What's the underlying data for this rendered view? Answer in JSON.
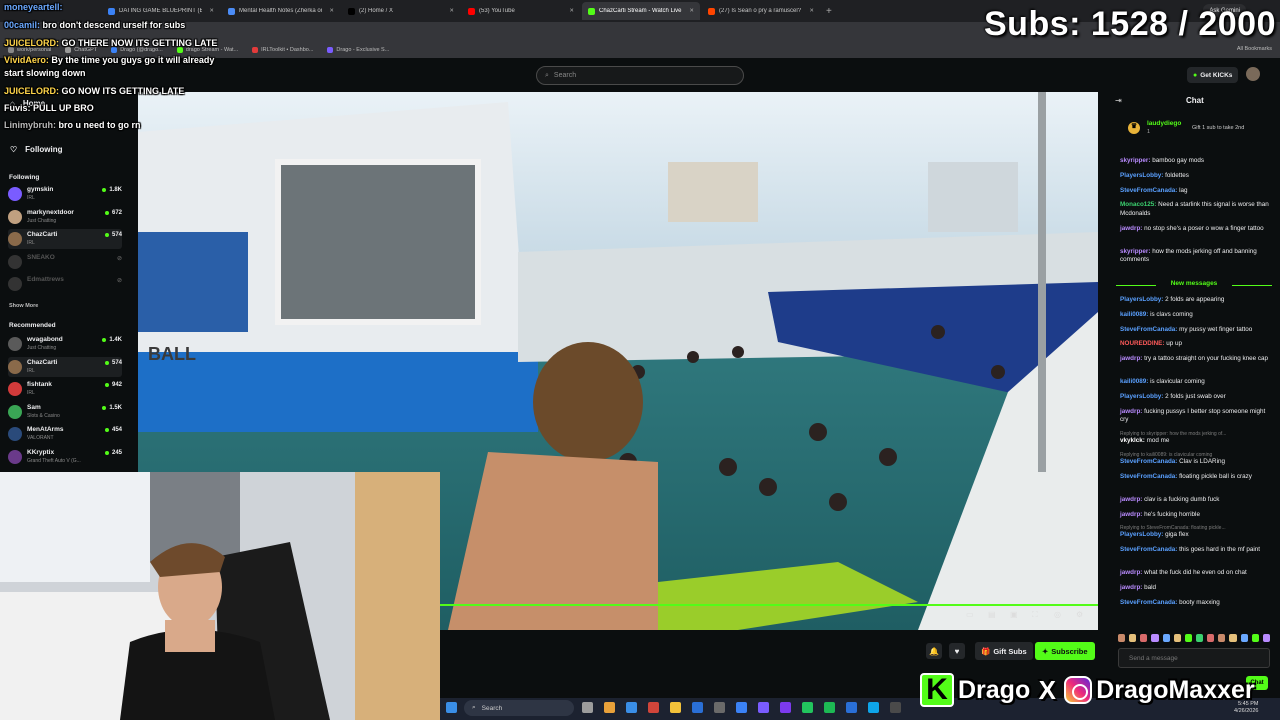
{
  "browser": {
    "tabs": [
      {
        "label": "DATING GAME BLUEPRINT (Be",
        "color": "#3b82f6",
        "active": false
      },
      {
        "label": "Mental Health Notes (Zherka or",
        "color": "#4b8cf6",
        "active": false
      },
      {
        "label": "(2) Home / X",
        "color": "#000000",
        "active": false
      },
      {
        "label": "(53) YouTube",
        "color": "#ff0000",
        "active": false
      },
      {
        "label": "ChazCarti Stream - Watch Live",
        "color": "#53fc18",
        "active": true
      },
      {
        "label": "(27) Is Sean o pry a ramuscel? |",
        "color": "#ff4500",
        "active": false
      }
    ],
    "ask_gemini": "Ask Gemini",
    "bookmarks": [
      "work/personal",
      "ChatGPT",
      "Drago (@drago...",
      "drago Stream - Wat...",
      "IRLToolkit • Dashbo...",
      "Drago - Exclusive S..."
    ],
    "all_bookmarks": "All Bookmarks"
  },
  "header": {
    "search_placeholder": "Search",
    "get_kicks": "Get KICKs"
  },
  "sidebar": {
    "nav_home": "Home",
    "nav_following": "Following",
    "following_title": "Following",
    "following": [
      {
        "name": "gymskin",
        "sub": "IRL",
        "viewers": "1.8K",
        "color": "#7a5cff",
        "off": false
      },
      {
        "name": "markynextdoor",
        "sub": "Just Chatting",
        "viewers": "672",
        "color": "#c0a080",
        "off": false
      },
      {
        "name": "ChazCarti",
        "sub": "IRL",
        "viewers": "574",
        "color": "#8a6a4a",
        "off": false
      },
      {
        "name": "SNEAKO",
        "sub": "",
        "viewers": "",
        "color": "#333333",
        "off": true
      },
      {
        "name": "Edmattrews",
        "sub": "",
        "viewers": "",
        "color": "#333333",
        "off": true
      }
    ],
    "show_more": "Show More",
    "recommended_title": "Recommended",
    "recommended": [
      {
        "name": "wvagabond",
        "sub": "Just Chatting",
        "viewers": "1.4K",
        "color": "#5a5a5a"
      },
      {
        "name": "ChazCarti",
        "sub": "IRL",
        "viewers": "574",
        "color": "#8a6a4a"
      },
      {
        "name": "fishtank",
        "sub": "IRL",
        "viewers": "942",
        "color": "#d23b3b"
      },
      {
        "name": "Sam",
        "sub": "Slots & Casino",
        "viewers": "1.5K",
        "color": "#3aa655"
      },
      {
        "name": "MenAtArms",
        "sub": "VALORANT",
        "viewers": "454",
        "color": "#2a4a7a"
      },
      {
        "name": "KKryptix",
        "sub": "Grand Theft Auto V (G...",
        "viewers": "245",
        "color": "#6a3a8a"
      }
    ]
  },
  "overlay_chat": [
    {
      "user": "moneyeartell:",
      "text": "",
      "color": "#6aa8ff"
    },
    {
      "user": "00camil:",
      "text": "bro don't descend urself for subs",
      "color": "#6aa8ff"
    },
    {
      "user": "JUICELORD:",
      "text": "GO THERE NOW ITS GETTING LATE",
      "color": "#ffd54a"
    },
    {
      "user": "VividAero:",
      "text": "By the time you guys go it will already",
      "color": "#ffd54a"
    },
    {
      "user": "",
      "text": "start slowing down",
      "color": "#ffffff"
    },
    {
      "user": "JUICELORD:",
      "text": "GO NOW ITS GETTING LATE",
      "color": "#ffd54a"
    },
    {
      "user": "Fuvis:",
      "text": "PULL UP BRO",
      "color": "#ffffff"
    },
    {
      "user": "Linimybruh:",
      "text": "bro u need to go rn",
      "color": "#b8b8b8"
    }
  ],
  "subs_counter": "Subs: 1528 / 2000",
  "stream": {
    "gift_subs": "Gift Subs",
    "subscribe": "Subscribe"
  },
  "chat": {
    "title": "Chat",
    "pinned_user": "laudydiego",
    "pinned_count": "1",
    "pinned_text": "Gift 1 sub to take 2nd",
    "messages_before": [
      {
        "user": "skyripper:",
        "text": "bamboo gay mods",
        "color": "#b98bff"
      },
      {
        "user": "PlayersLobby:",
        "text": "foldettes",
        "color": "#5aa0ff"
      },
      {
        "user": "SteveFromCanada:",
        "text": "lag",
        "color": "#5aa0ff"
      },
      {
        "user": "Monaco125:",
        "text": "Need a starlink this signal is worse than Mcdonalds",
        "color": "#3bd16f"
      },
      {
        "user": "jawdrp:",
        "text": "no stop she's a poser o wow a finger tattoo",
        "color": "#b98bff"
      },
      {
        "user": "skyripper:",
        "text": "how the mods jerking off and banning comments",
        "color": "#b98bff"
      }
    ],
    "new_messages": "New messages",
    "messages_after": [
      {
        "user": "PlayersLobby:",
        "text": "2 folds are appearing",
        "color": "#5aa0ff",
        "reply": ""
      },
      {
        "user": "kaili0089:",
        "text": "is clavs coming",
        "color": "#5aa0ff",
        "reply": ""
      },
      {
        "user": "SteveFromCanada:",
        "text": "my pussy wet finger tattoo",
        "color": "#5aa0ff",
        "reply": ""
      },
      {
        "user": "NOUREDDINE:",
        "text": "up up",
        "color": "#ff5a5a",
        "reply": ""
      },
      {
        "user": "jawdrp:",
        "text": "try a tattoo straight on your fucking knee cap",
        "color": "#b98bff",
        "reply": ""
      },
      {
        "user": "kaili0089:",
        "text": "is clavicular coming",
        "color": "#5aa0ff",
        "reply": ""
      },
      {
        "user": "PlayersLobby:",
        "text": "2 folds just swab over",
        "color": "#5aa0ff",
        "reply": ""
      },
      {
        "user": "jawdrp:",
        "text": "fucking pussys I better stop someone might cry",
        "color": "#b98bff",
        "reply": ""
      },
      {
        "user": "vkyklck:",
        "text": "mod me",
        "color": "#ffffff",
        "reply": "Replying to skyripper: how the mods jerking of..."
      },
      {
        "user": "SteveFromCanada:",
        "text": "Clav is LDARing",
        "color": "#5aa0ff",
        "reply": "Replying to kaili0089: is clavicular coming"
      },
      {
        "user": "SteveFromCanada:",
        "text": "floating pickle ball is crazy",
        "color": "#5aa0ff",
        "reply": ""
      },
      {
        "user": "jawdrp:",
        "text": "clav is a fucking dumb fuck",
        "color": "#b98bff",
        "reply": ""
      },
      {
        "user": "jawdrp:",
        "text": "he's fucking horrible",
        "color": "#b98bff",
        "reply": ""
      },
      {
        "user": "PlayersLobby:",
        "text": "giga flex",
        "color": "#5aa0ff",
        "reply": "Replying to SteveFromCanada: floating pickle..."
      },
      {
        "user": "SteveFromCanada:",
        "text": "this goes hard in the mf paint",
        "color": "#5aa0ff",
        "reply": ""
      },
      {
        "user": "jawdrp:",
        "text": "what the fuck did he even od on chat",
        "color": "#b98bff",
        "reply": ""
      },
      {
        "user": "jawdrp:",
        "text": "bald",
        "color": "#b98bff",
        "reply": ""
      },
      {
        "user": "SteveFromCanada:",
        "text": "booty maxxing",
        "color": "#5aa0ff",
        "reply": ""
      }
    ],
    "send_placeholder": "Send a message",
    "chat_button": "Chat"
  },
  "taskbar": {
    "search": "Search",
    "time": "5:45 PM",
    "date": "4/26/2026"
  },
  "branding": {
    "name_1": "Drago",
    "name_2": "DragoMaxxer"
  },
  "colors": {
    "accent": "#53fc18",
    "background": "#0b0e0f"
  }
}
